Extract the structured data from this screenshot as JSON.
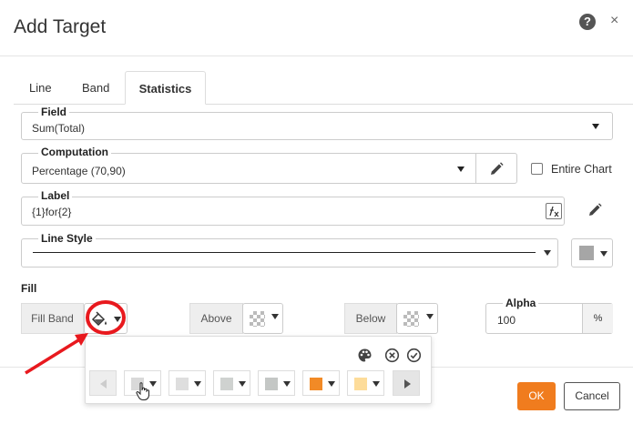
{
  "dialog": {
    "title": "Add Target",
    "help_glyph": "?",
    "close_glyph": "×"
  },
  "tabs": [
    {
      "label": "Line",
      "active": false
    },
    {
      "label": "Band",
      "active": false
    },
    {
      "label": "Statistics",
      "active": true
    }
  ],
  "form": {
    "field": {
      "label": "Field",
      "value": "Sum(Total)"
    },
    "computation": {
      "label": "Computation",
      "value": "Percentage (70,90)"
    },
    "entire_chart": {
      "label": "Entire Chart",
      "checked": false
    },
    "label_field": {
      "label": "Label",
      "value": "{1}for{2}"
    },
    "line_style": {
      "label": "Line Style"
    },
    "line_style_color": "#a6a6a6"
  },
  "fill": {
    "heading": "Fill",
    "fill_band_label": "Fill Band",
    "above_label": "Above",
    "below_label": "Below",
    "alpha": {
      "label": "Alpha",
      "value": "100",
      "unit": "%"
    }
  },
  "palette": {
    "swatches": [
      "#d9d9d9",
      "#dedede",
      "#cfd2d0",
      "#c4c7c5",
      "#f28a26",
      "#fddc9a"
    ],
    "icons": [
      "palette-icon",
      "clear-circle-icon",
      "confirm-circle-icon"
    ]
  },
  "annotation": {
    "color": "#e8191e"
  },
  "footer": {
    "ok_label": "OK",
    "cancel_label": "Cancel",
    "ok_color": "#f07c1e"
  }
}
